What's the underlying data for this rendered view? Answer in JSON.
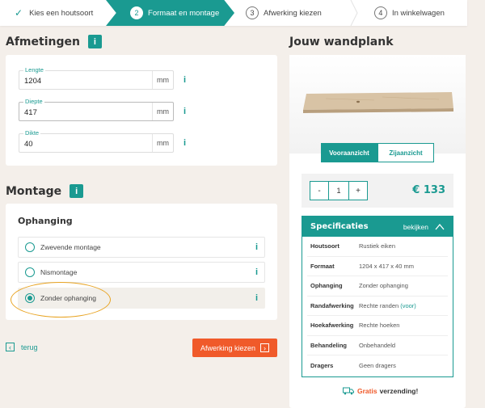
{
  "steps": [
    {
      "label": "Kies een houtsoort"
    },
    {
      "num": "2",
      "label": "Formaat en montage"
    },
    {
      "num": "3",
      "label": "Afwerking kiezen"
    },
    {
      "num": "4",
      "label": "In winkelwagen"
    }
  ],
  "afmetingen": {
    "title": "Afmetingen",
    "info": "i",
    "fields": [
      {
        "label": "Lengte",
        "value": "1204",
        "unit": "mm",
        "info": "i"
      },
      {
        "label": "Diepte",
        "value": "417",
        "unit": "mm",
        "info": "i"
      },
      {
        "label": "Dikte",
        "value": "40",
        "unit": "mm",
        "info": "i"
      }
    ]
  },
  "montage": {
    "title": "Montage",
    "info": "i",
    "subtitle": "Ophanging",
    "options": [
      {
        "label": "Zwevende montage",
        "selected": false,
        "info": "i"
      },
      {
        "label": "Nismontage",
        "selected": false,
        "info": "i"
      },
      {
        "label": "Zonder ophanging",
        "selected": true,
        "info": "i"
      }
    ]
  },
  "nav": {
    "back": "terug",
    "next": "Afwerking kiezen"
  },
  "product": {
    "title": "Jouw wandplank",
    "views": [
      "Vooraanzicht",
      "Zijaanzicht"
    ],
    "quantity": "1",
    "minus": "-",
    "plus": "+",
    "price": "€ 133"
  },
  "specs": {
    "title": "Specificaties",
    "toggle": "bekijken",
    "rows": [
      {
        "k": "Houtsoort",
        "v": "Rustiek eiken",
        "note": ""
      },
      {
        "k": "Formaat",
        "v": "1204 x 417 x 40 mm",
        "note": ""
      },
      {
        "k": "Ophanging",
        "v": "Zonder ophanging",
        "note": ""
      },
      {
        "k": "Randafwerking",
        "v": "Rechte randen",
        "note": "(voor)"
      },
      {
        "k": "Hoekafwerking",
        "v": "Rechte hoeken",
        "note": ""
      },
      {
        "k": "Behandeling",
        "v": "Onbehandeld",
        "note": ""
      },
      {
        "k": "Dragers",
        "v": "Geen dragers",
        "note": ""
      }
    ]
  },
  "shipping": {
    "gratis": "Gratis",
    "rest": "verzending!"
  },
  "colors": {
    "accent": "#1a9a91",
    "cta": "#f05a2a",
    "highlight": "#e8a321"
  }
}
